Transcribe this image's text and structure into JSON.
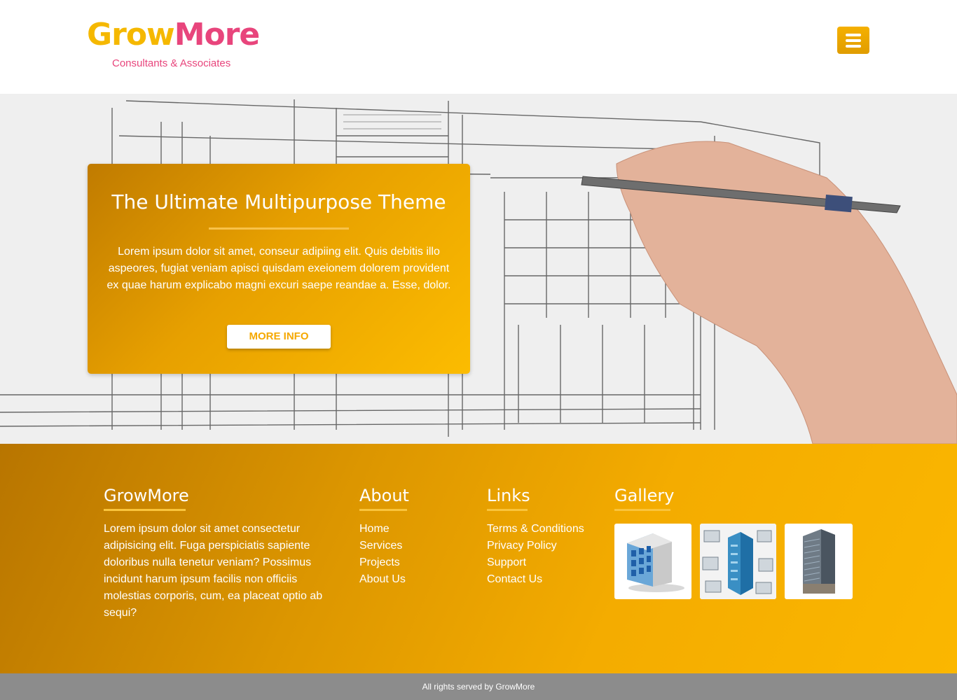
{
  "header": {
    "logo_part1": "Grow",
    "logo_part2": "More",
    "tagline": "Consultants & Associates",
    "colors": {
      "brand_yellow": "#f5b800",
      "brand_pink": "#e8457c"
    }
  },
  "hero": {
    "title": "The Ultimate Multipurpose Theme",
    "text": "Lorem ipsum dolor sit amet, conseur adipiing elit. Quis debitis illo aspeores, fugiat veniam apisci quisdam exeionem dolorem provident ex quae harum explicabo magni excuri saepe reandae a. Esse, dolor.",
    "button_label": "MORE INFO"
  },
  "footer": {
    "about_brand": {
      "title": "GrowMore",
      "text": "Lorem ipsum dolor sit amet consectetur adipisicing elit. Fuga perspiciatis sapiente doloribus nulla tenetur veniam? Possimus incidunt harum ipsum facilis non officiis molestias corporis, cum, ea placeat optio ab sequi?"
    },
    "about": {
      "title": "About",
      "links": [
        "Home",
        "Services",
        "Projects",
        "About Us"
      ]
    },
    "links": {
      "title": "Links",
      "links": [
        "Terms & Conditions",
        "Privacy Policy",
        "Support",
        "Contact Us"
      ]
    },
    "gallery": {
      "title": "Gallery",
      "images": [
        "building-icon",
        "isometric-office-building",
        "tower-building-photo"
      ]
    }
  },
  "bottom": {
    "copyright": "All rights served by GrowMore"
  }
}
